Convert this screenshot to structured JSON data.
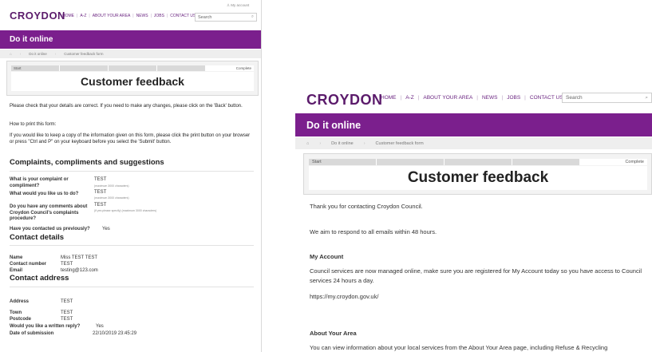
{
  "header": {
    "logo": "CROYDON",
    "my_account": "♙ My account",
    "nav": [
      "HOME",
      "A-Z",
      "ABOUT YOUR AREA",
      "NEWS",
      "JOBS",
      "CONTACT US"
    ],
    "search_placeholder": "Search"
  },
  "band_title": "Do it online",
  "breadcrumb": [
    "Do it online",
    "Customer feedback form"
  ],
  "progress": {
    "start": "Start",
    "complete": "Complete"
  },
  "page_title": "Customer feedback",
  "left": {
    "intro": "Please check that your details are correct. If you need to make any changes, please click on the 'Back' button.",
    "print_heading": "How to print this form:",
    "print_text": "If you would like to keep a copy of the information given on this form, please click the print button on your browser or press \"Ctrl and P\" on your keyboard before you select the 'Submit' button.",
    "section_complaints": "Complaints, compliments and suggestions",
    "q1_label": "What is your complaint or compliment?",
    "q1_value": "TEST",
    "q1_hint": "(maximum 3000 characters)",
    "q2_label": "What would you like us to do?",
    "q2_value": "TEST",
    "q2_hint": "(maximum 3000 characters)",
    "q3_label": "Do you have any comments about Croydon Council's complaints procedure?",
    "q3_value": "TEST",
    "q3_hint": "(if yes please specify) (maximum 3000 characters)",
    "q4_label": "Have you contacted us previously?",
    "q4_value": "Yes",
    "section_contact": "Contact details",
    "name_label": "Name",
    "name_value": "Miss TEST TEST",
    "number_label": "Contact number",
    "number_value": "TEST",
    "email_label": "Email",
    "email_value": "testing@123.com",
    "section_address": "Contact address",
    "address_label": "Address",
    "address_value": "TEST",
    "town_label": "Town",
    "town_value": "TEST",
    "postcode_label": "Postcode",
    "postcode_value": "TEST",
    "reply_label": "Would you like a written reply?",
    "reply_value": "Yes",
    "date_label": "Date of submission",
    "date_value": "22/10/2019 23:45:29"
  },
  "right": {
    "thanks": "Thank you for contacting Croydon Council.",
    "respond": "We aim to respond to all emails within 48 hours.",
    "my_account_heading": "My Account",
    "my_account_text": "Council services are now managed online, make sure you are registered for My Account today so you have access to Council services 24 hours a day.",
    "my_account_url": "https://my.croydon.gov.uk/",
    "area_heading": "About Your Area",
    "area_text": "You can view information about your local services from the About Your Area page, including Refuse & Recycling"
  },
  "colors": {
    "brand_purple": "#7b1f8d",
    "logo_purple": "#5b1b6b"
  }
}
